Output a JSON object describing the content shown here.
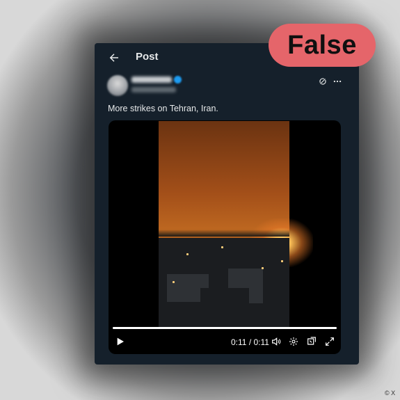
{
  "header": {
    "title": "Post",
    "back_icon": "arrow-left-icon"
  },
  "author": {
    "display_name": "",
    "handle": "",
    "verified": true
  },
  "post": {
    "text": "More strikes on Tehran, Iran."
  },
  "video": {
    "elapsed": "0:11",
    "separator": "/",
    "duration": "0:11",
    "progress_fraction": 1.0,
    "controls": [
      "play-icon",
      "volume-icon",
      "settings-icon",
      "pip-icon",
      "fullscreen-icon"
    ]
  },
  "verdict": {
    "label": "False",
    "color": "#e5656a"
  },
  "credit": {
    "text": "© X"
  },
  "colors": {
    "card_bg": "#15202b",
    "text": "#e7e9ea",
    "verified": "#1d9bf0"
  }
}
